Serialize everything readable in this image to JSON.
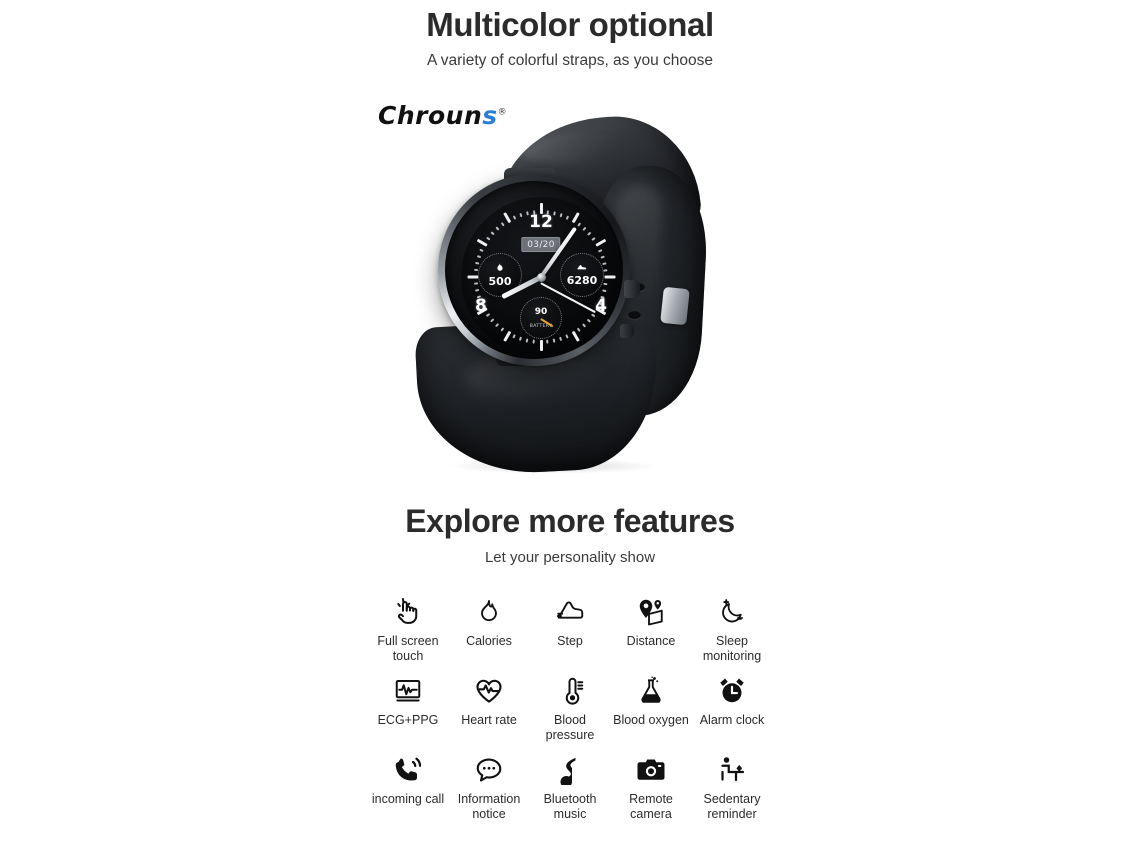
{
  "hero": {
    "title": "Multicolor optional",
    "subtitle": "A variety of colorful straps, as you choose"
  },
  "brand": {
    "name_part1": "Chroun",
    "name_accent": "s",
    "trademark": "®",
    "accent_color": "#2a7fd4"
  },
  "watch": {
    "date_window": "03/20",
    "numerals": {
      "twelve": "12",
      "four": "4",
      "eight": "8"
    },
    "subdials": [
      {
        "name": "calories",
        "value": "500",
        "icon": "flame-icon",
        "glyph": "♣"
      },
      {
        "name": "steps",
        "value": "6280",
        "icon": "shoe-icon",
        "glyph": "◢"
      },
      {
        "name": "battery",
        "value": "90",
        "label": "BATTERY",
        "icon": "battery-gauge-icon"
      }
    ],
    "case_color": "#1a1c1f",
    "strap_color": "#212428",
    "buckle_color": "#a9aeb4",
    "needle_color": "#e8a33a"
  },
  "features": {
    "title": "Explore more features",
    "subtitle": "Let your personality show",
    "rows": [
      [
        {
          "icon": "touch-hand-icon",
          "label": "Full screen touch"
        },
        {
          "icon": "flame-icon",
          "label": "Calories"
        },
        {
          "icon": "shoe-icon",
          "label": "Step"
        },
        {
          "icon": "map-pin-icon",
          "label": "Distance"
        },
        {
          "icon": "moon-sparkle-icon",
          "label": "Sleep monitoring"
        }
      ],
      [
        {
          "icon": "ecg-monitor-icon",
          "label": "ECG+PPG"
        },
        {
          "icon": "heart-pulse-icon",
          "label": "Heart rate"
        },
        {
          "icon": "thermometer-icon",
          "label": "Blood pressure"
        },
        {
          "icon": "flask-icon",
          "label": "Blood oxygen"
        },
        {
          "icon": "alarm-clock-icon",
          "label": "Alarm clock"
        }
      ],
      [
        {
          "icon": "phone-ringing-icon",
          "label": "incoming call"
        },
        {
          "icon": "chat-bubble-icon",
          "label": "Information notice"
        },
        {
          "icon": "music-note-icon",
          "label": "Bluetooth music"
        },
        {
          "icon": "camera-icon",
          "label": "Remote camera"
        },
        {
          "icon": "sedentary-person-icon",
          "label": "Sedentary reminder"
        }
      ]
    ]
  },
  "colors": {
    "background": "#ffffff",
    "text": "#2b2b2b"
  }
}
